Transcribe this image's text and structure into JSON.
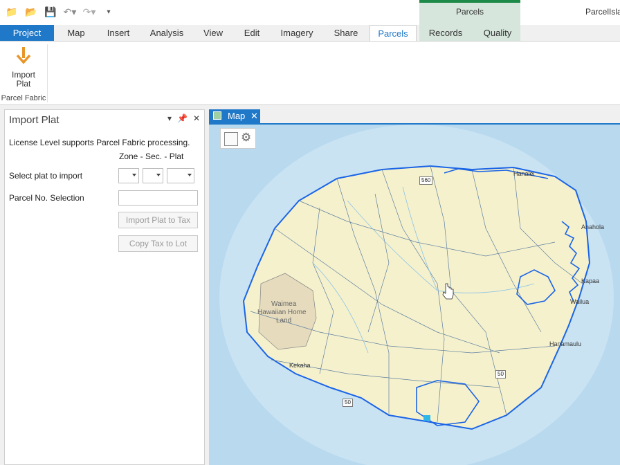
{
  "window": {
    "app_title": "ParcelIsla",
    "context_group": "Parcels"
  },
  "qat": {
    "icons": [
      "new-project-icon",
      "open-icon",
      "save-icon",
      "undo-icon",
      "redo-icon",
      "customize-icon"
    ]
  },
  "tabs": [
    "Project",
    "Map",
    "Insert",
    "Analysis",
    "View",
    "Edit",
    "Imagery",
    "Share",
    "Parcels",
    "Records",
    "Quality"
  ],
  "ribbon": {
    "import_plat_label_1": "Import",
    "import_plat_label_2": "Plat",
    "group_label": "Parcel Fabric"
  },
  "pane": {
    "title": "Import Plat",
    "license_text": "License Level supports Parcel Fabric processing.",
    "zone_header": "Zone - Sec. - Plat",
    "select_plat_label": "Select plat to import",
    "parcel_no_label": "Parcel No. Selection",
    "parcel_no_value": "",
    "import_plat_to_tax": "Import Plat to Tax",
    "copy_tax_to_lot": "Copy Tax to Lot"
  },
  "map": {
    "tab_label": "Map",
    "place_labels": [
      "Waimea",
      "Hawaiian Home",
      "Land",
      "Kekaha",
      "Hanalei",
      "Anahola",
      "Kapaa",
      "Wailua",
      "Hanamaulu"
    ],
    "highways": [
      "560",
      "50",
      "50"
    ]
  },
  "colors": {
    "accent": "#1f78c8",
    "ocean": "#b9d9ee",
    "land": "#f5f1cd",
    "parcel_lines": "#1a64e6",
    "context_tab": "#1e8a4a"
  }
}
